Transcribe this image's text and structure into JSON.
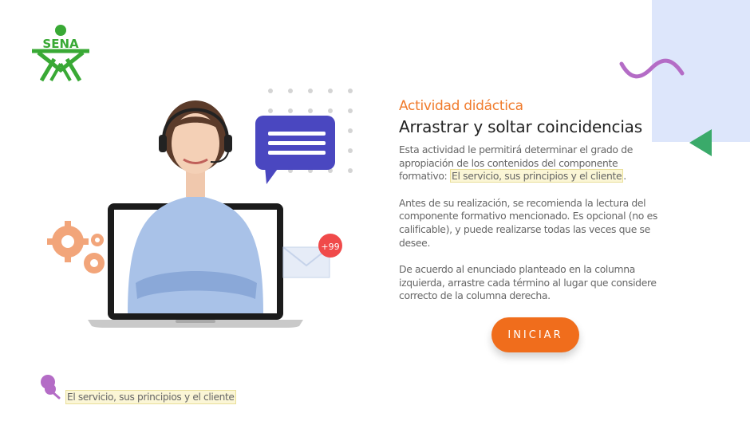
{
  "brand": {
    "logo_text": "SENA",
    "logo_color": "#39a935"
  },
  "activity": {
    "eyebrow": "Actividad didáctica",
    "title": "Arrastrar y soltar coincidencias",
    "para1_prefix": "Esta actividad le permitirá determinar el grado de apropiación de los contenidos del componente formativo: ",
    "para1_highlight": "El servicio, sus principios y el cliente",
    "para1_suffix": ".",
    "para2": "Antes de su realización, se recomienda la lectura del componente formativo mencionado.  Es opcional (no es calificable), y puede realizarse todas las veces que se desee.",
    "para3": "De acuerdo al enunciado planteado en la columna izquierda, arrastre cada término al lugar que considere correcto de la columna derecha."
  },
  "start_button": {
    "label": "INICIAR",
    "color": "#f06d1c"
  },
  "illustration": {
    "badge_text": "+99"
  },
  "footer": {
    "note": "El servicio, sus principios y el cliente"
  },
  "colors": {
    "accent_orange": "#f07b2c",
    "panel_blue": "#dde6fb",
    "wave_purple": "#b46cc6",
    "triangle_green": "#3aaa6a"
  },
  "icons": [
    "sena-logo-icon",
    "wave-icon",
    "triangle-icon",
    "chat-bubble-icon",
    "gear-icon",
    "envelope-icon",
    "pin-icon"
  ]
}
